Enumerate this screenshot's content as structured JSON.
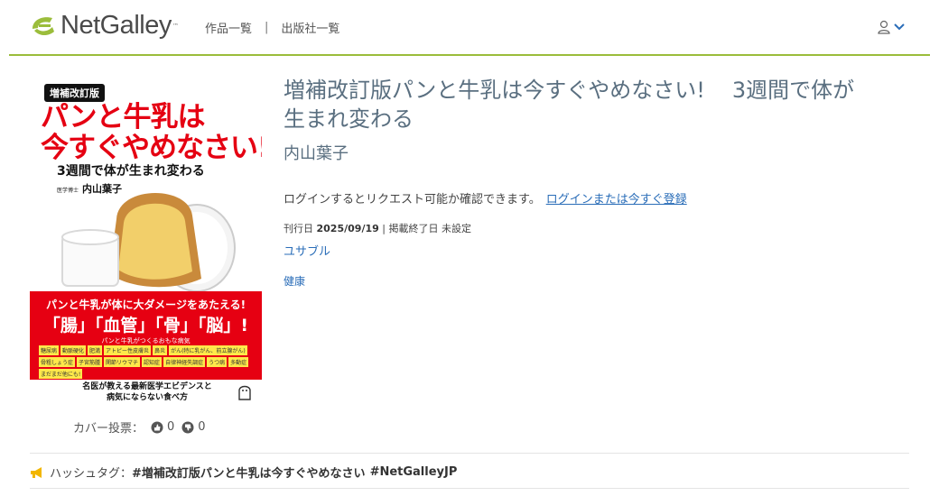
{
  "header": {
    "logo_text": "NetGalley",
    "logo_tm": "™",
    "nav_titles": "作品一覧",
    "nav_sep": "|",
    "nav_publishers": "出版社一覧",
    "brand_color": "#9bbd3b"
  },
  "cover": {
    "badge": "増補改訂版",
    "title_line1": "パンと牛乳は",
    "title_line2": "今すぐやめなさい!",
    "subtitle": "3週間で体が生まれ変わる",
    "author_prefix": "医学博士",
    "author": "内山葉子",
    "band_line1": "パンと牛乳が体に大ダメージをあたえる!",
    "band_line2": "「腸」「血管」「骨」「脳」!",
    "band_line3": "パンと牛乳がつくるおもな病気",
    "band_tags": [
      "糖尿病",
      "動脈硬化",
      "肥満",
      "アトピー性皮膚炎",
      "鼻炎",
      "がん(特に乳がん、前立腺がん)",
      "骨粗しょう症",
      "子宮筋腫",
      "関節リウマチ",
      "認知症",
      "自律神経失調症",
      "うつ病",
      "多動症",
      "まだまだ他にも!"
    ],
    "bottom_line1": "名医が教える最新医学エビデンスと",
    "bottom_line2": "病気にならない食べ方",
    "accent_red": "#e60012"
  },
  "votes": {
    "label": "カバー投票：",
    "up_count": "0",
    "down_count": "0"
  },
  "book": {
    "title_part1": "増補改訂版パンと牛乳は今すぐやめなさい!",
    "title_part2": "3週間で体が生まれ変わる",
    "author": "内山葉子",
    "login_note": "ログインするとリクエスト可能か確認できます。",
    "login_link": "ログインまたは今すぐ登録",
    "pub_date_label": "刊行日",
    "pub_date": "2025/09/19",
    "meta_sep": "|",
    "end_label": "掲載終了日",
    "end_value": "未設定",
    "publisher": "ユサブル",
    "category": "健康"
  },
  "hashtag": {
    "label": "ハッシュタグ：",
    "tag1": "#増補改訂版パンと牛乳は今すぐやめなさい",
    "tag2": "#NetGalleyJP"
  }
}
